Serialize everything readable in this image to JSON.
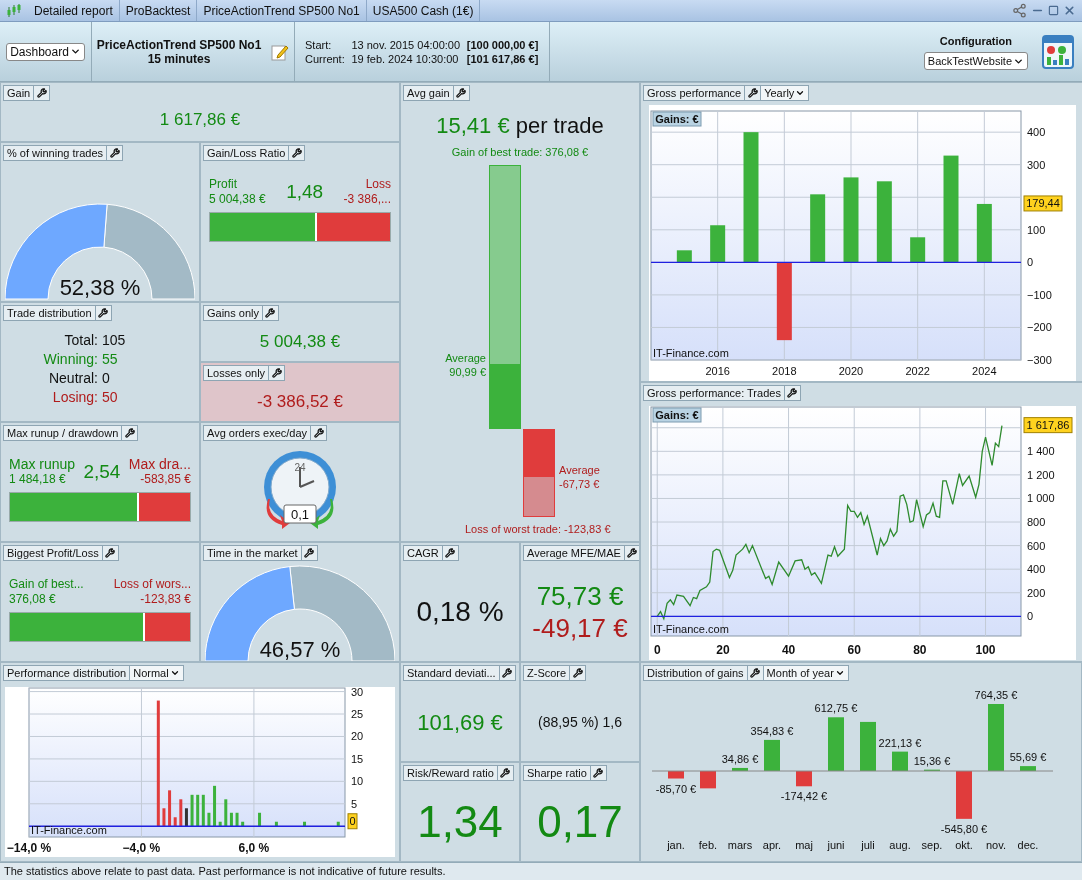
{
  "breadcrumbs": [
    "Detailed report",
    "ProBacktest",
    "PriceActionTrend SP500 No1",
    "USA500 Cash (1€)"
  ],
  "view_select": {
    "value": "Dashboard"
  },
  "strategy": {
    "name": "PriceActionTrend SP500 No1",
    "timeframe": "15 minutes"
  },
  "period": [
    {
      "label": "Start:",
      "date": "13 nov. 2015 04:00:00",
      "capital": "[100 000,00 €]"
    },
    {
      "label": "Current:",
      "date": "19 feb. 2024 10:30:00",
      "capital": "[101 617,86 €]"
    }
  ],
  "configuration": {
    "label": "Configuration",
    "value": "BackTestWebsite"
  },
  "gain": {
    "title": "Gain",
    "wrench": true,
    "value": "1 617,86 €"
  },
  "winning_trades": {
    "title": "% of winning trades",
    "wrench": true,
    "value": "52,38 %",
    "level": 0.5238
  },
  "gain_loss_ratio": {
    "title": "Gain/Loss Ratio",
    "wrench": true,
    "left": {
      "label": "Profit",
      "value": "5 004,38 €"
    },
    "ratio": "1,48",
    "right": {
      "label": "Loss",
      "value": "-3 386,..."
    },
    "level": 0.596
  },
  "trade_distribution": {
    "title": "Trade distribution",
    "wrench": true,
    "rows": [
      {
        "kind": "total",
        "label": "Total:",
        "value": "105"
      },
      {
        "kind": "winning",
        "label": "Winning:",
        "value": "55"
      },
      {
        "kind": "neutral",
        "label": "Neutral:",
        "value": "0"
      },
      {
        "kind": "losing",
        "label": "Losing:",
        "value": "50"
      }
    ]
  },
  "gains_only": {
    "title": "Gains only",
    "wrench": true,
    "value": "5 004,38 €"
  },
  "losses_only": {
    "title": "Losses only",
    "wrench": true,
    "value": "-3 386,52 €"
  },
  "max_runup_drawdown": {
    "title": "Max runup / drawdown",
    "wrench": true,
    "left": {
      "label": "Max runup",
      "value": "1 484,18 €"
    },
    "ratio": "2,54",
    "right": {
      "label": "Max dra...",
      "value": "-583,85 €"
    },
    "level": 0.718
  },
  "avg_orders": {
    "title": "Avg orders exec/day",
    "wrench": true,
    "clock_label": "24",
    "value": "0,1"
  },
  "biggest_profit_loss": {
    "title": "Biggest Profit/Loss",
    "wrench": true,
    "left": {
      "label": "Gain of best...",
      "value": "376,08 €"
    },
    "right": {
      "label": "Loss of wors...",
      "value": "-123,83 €"
    },
    "level": 0.752
  },
  "time_in_market": {
    "title": "Time in the market",
    "wrench": true,
    "value": "46,57 %",
    "level": 0.4657
  },
  "avg_gain": {
    "title": "Avg gain",
    "wrench": true,
    "value": "15,41 €",
    "suffix": "per trade",
    "best": "Gain of best trade: 376,08 €",
    "gain_average_label": "Average",
    "gain_average": "90,99 €",
    "gain_bar": {
      "level": 0.242
    },
    "loss_average_label": "Average",
    "loss_average": "-67,73 €",
    "loss_bar": {
      "level": 0.547
    },
    "worst": "Loss of worst trade: -123,83 €"
  },
  "cagr": {
    "title": "CAGR",
    "wrench": true,
    "value": "0,18 %"
  },
  "mfe_mae": {
    "title": "Average MFE/MAE",
    "wrench": true,
    "mfe": "75,73 €",
    "mae": "-49,17 €"
  },
  "gross_performance": {
    "title": "Gross performance",
    "wrench": true,
    "select": "Yearly",
    "series_label": "Gains: €",
    "credit": "IT-Finance.com",
    "last_value": "179,44",
    "chart_data": {
      "type": "bar",
      "x": [
        2015,
        2016,
        2017,
        2018,
        2019,
        2020,
        2021,
        2022,
        2023,
        2024
      ],
      "series": [
        {
          "color": "#3cb23c",
          "values": [
            37,
            114,
            400,
            null,
            209,
            261,
            249,
            77,
            328,
            179.44
          ]
        },
        {
          "color": "#e03c3c",
          "values": [
            null,
            null,
            null,
            -239,
            null,
            null,
            null,
            null,
            null,
            null
          ]
        }
      ],
      "grid": true,
      "ref_lines": [
        {
          "axis": "y",
          "value": 0,
          "color": "#2020e0"
        }
      ],
      "xlim": [
        2014,
        2025.1
      ],
      "ylim": [
        -300,
        465
      ],
      "xticks": [
        2016,
        2018,
        2020,
        2022,
        2024
      ],
      "yticks": [
        {
          "value": -300,
          "label": "−300"
        },
        {
          "value": -200,
          "label": "−200"
        },
        {
          "value": -100,
          "label": "−100"
        },
        {
          "value": 0,
          "label": "0"
        },
        {
          "value": 100,
          "label": "100"
        },
        {
          "value": 300,
          "label": "300"
        },
        {
          "value": 400,
          "label": "400"
        }
      ]
    }
  },
  "trades_performance": {
    "title": "Gross performance: Trades",
    "wrench": true,
    "series_label": "Gains: €",
    "credit": "IT-Finance.com",
    "last_value": "1 617,86",
    "chart_data": {
      "type": "line",
      "x": [
        0,
        1,
        2,
        3,
        4,
        5,
        6,
        8,
        10,
        11,
        12,
        13,
        15,
        16,
        17,
        18,
        19,
        22,
        23,
        24,
        26,
        27,
        28,
        29,
        33,
        34,
        35,
        37,
        40,
        42,
        44,
        45,
        46,
        47,
        48,
        50,
        52,
        53,
        54,
        55,
        57,
        58,
        59,
        60,
        61,
        62,
        63,
        64,
        67,
        68,
        69,
        70,
        71,
        72,
        73,
        74,
        75,
        76,
        77,
        78,
        79,
        81,
        82,
        83,
        84,
        85,
        86,
        87,
        88,
        90,
        92,
        93,
        95,
        97,
        98,
        99,
        100,
        102,
        103,
        104,
        105
      ],
      "series": [
        {
          "color": "#2e8b2e",
          "values": [
            0,
            40,
            -20,
            110,
            140,
            100,
            180,
            170,
            90,
            160,
            150,
            220,
            250,
            290,
            550,
            570,
            560,
            330,
            390,
            520,
            570,
            610,
            540,
            600,
            320,
            340,
            270,
            460,
            340,
            470,
            480,
            400,
            420,
            350,
            370,
            280,
            520,
            510,
            590,
            510,
            570,
            940,
            890,
            890,
            840,
            880,
            780,
            850,
            520,
            660,
            600,
            640,
            740,
            680,
            720,
            1020,
            1030,
            950,
            800,
            810,
            990,
            760,
            860,
            880,
            960,
            850,
            840,
            1150,
            1150,
            950,
            1210,
            1110,
            1190,
            1010,
            1120,
            1400,
            1520,
            1280,
            1470,
            1440,
            1617.86
          ]
        }
      ],
      "grid": true,
      "ref_lines": [
        {
          "axis": "y",
          "value": 0,
          "color": "#2020e0"
        }
      ],
      "xlim": [
        -1.9,
        110.8
      ],
      "ylim": [
        -167,
        1776
      ],
      "xticks": [
        0,
        20,
        40,
        60,
        80,
        100
      ],
      "yticks": [
        {
          "value": 0,
          "label": "0"
        },
        {
          "value": 200,
          "label": "200"
        },
        {
          "value": 400,
          "label": "400"
        },
        {
          "value": 600,
          "label": "600"
        },
        {
          "value": 800,
          "label": "800"
        },
        {
          "value": 1000,
          "label": "1 000"
        },
        {
          "value": 1200,
          "label": "1 200"
        },
        {
          "value": 1400,
          "label": "1 400"
        }
      ]
    }
  },
  "performance_distribution": {
    "title": "Performance distribution",
    "wrench": false,
    "select": "Normal",
    "credit": "IT-Finance.com",
    "last_value": "0",
    "chart_data": {
      "type": "bar",
      "x": [
        -2.5,
        -2.0,
        -1.5,
        -1.0,
        -0.5,
        0,
        0.5,
        1.0,
        1.5,
        2.0,
        2.5,
        3.0,
        3.5,
        4.0,
        4.5,
        5.0,
        6.5,
        8.0,
        10.5,
        13.5
      ],
      "series": [
        {
          "color": "#e03c3c",
          "values": [
            28,
            4,
            8,
            2,
            6,
            null,
            null,
            null,
            null,
            null,
            null,
            null,
            null,
            null,
            null,
            null,
            null,
            null,
            null,
            null
          ]
        },
        {
          "color": "#333333",
          "values": [
            null,
            null,
            null,
            null,
            null,
            4,
            null,
            null,
            null,
            null,
            null,
            null,
            null,
            null,
            null,
            null,
            null,
            null,
            null,
            null
          ]
        },
        {
          "color": "#3cb23c",
          "values": [
            null,
            null,
            null,
            null,
            null,
            null,
            7,
            7,
            7,
            3,
            9,
            1,
            6,
            3,
            3,
            1,
            3,
            1,
            1,
            1
          ]
        }
      ],
      "grid": true,
      "ref_lines": [
        {
          "axis": "y",
          "value": 0,
          "color": "#2020e0"
        }
      ],
      "xlim": [
        -14,
        14.1
      ],
      "ylim": [
        -2.4,
        30.8
      ],
      "xticks": [
        {
          "value": -14,
          "label": "−14,0 %"
        },
        {
          "value": -4,
          "label": "−4,0 %"
        },
        {
          "value": 6,
          "label": "6,0 %"
        }
      ],
      "yticks": [
        5,
        10,
        15,
        20,
        25,
        30
      ]
    }
  },
  "standard_deviation": {
    "title": "Standard deviati...",
    "wrench": true,
    "value": "101,69 €"
  },
  "z_score": {
    "title": "Z-Score",
    "wrench": true,
    "value": "(88,95 %) 1,6"
  },
  "risk_reward": {
    "title": "Risk/Reward ratio",
    "wrench": true,
    "value": "1,34"
  },
  "sharpe": {
    "title": "Sharpe ratio",
    "wrench": true,
    "value": "0,17"
  },
  "gains_distribution": {
    "title": "Distribution of gains",
    "wrench": true,
    "select": "Month of year",
    "chart_data": {
      "type": "bar",
      "categories": [
        "jan.",
        "feb.",
        "mars",
        "apr.",
        "maj",
        "juni",
        "juli",
        "aug.",
        "sep.",
        "okt.",
        "nov.",
        "dec."
      ],
      "series": [
        {
          "color": "#3cb23c",
          "values": [
            null,
            null,
            34.86,
            354.83,
            null,
            612.75,
            560,
            221.13,
            15.36,
            null,
            764.35,
            55.69
          ],
          "value_labels": [
            null,
            null,
            "34,86 €",
            "354,83 €",
            null,
            "612,75 €",
            null,
            "221,13 €",
            "15,36 €",
            null,
            "764,35 €",
            "55,69 €"
          ]
        },
        {
          "color": "#e03c3c",
          "values": [
            -85.7,
            -198,
            null,
            null,
            -174.42,
            null,
            null,
            null,
            null,
            -545.8,
            null,
            null
          ],
          "value_labels": [
            "-85,70 €",
            null,
            null,
            null,
            "-174,42 €",
            null,
            null,
            null,
            null,
            "-545,80 €",
            null,
            null
          ]
        }
      ]
    }
  },
  "status_bar": "The statistics above relate to past data. Past performance is not indicative of future results."
}
